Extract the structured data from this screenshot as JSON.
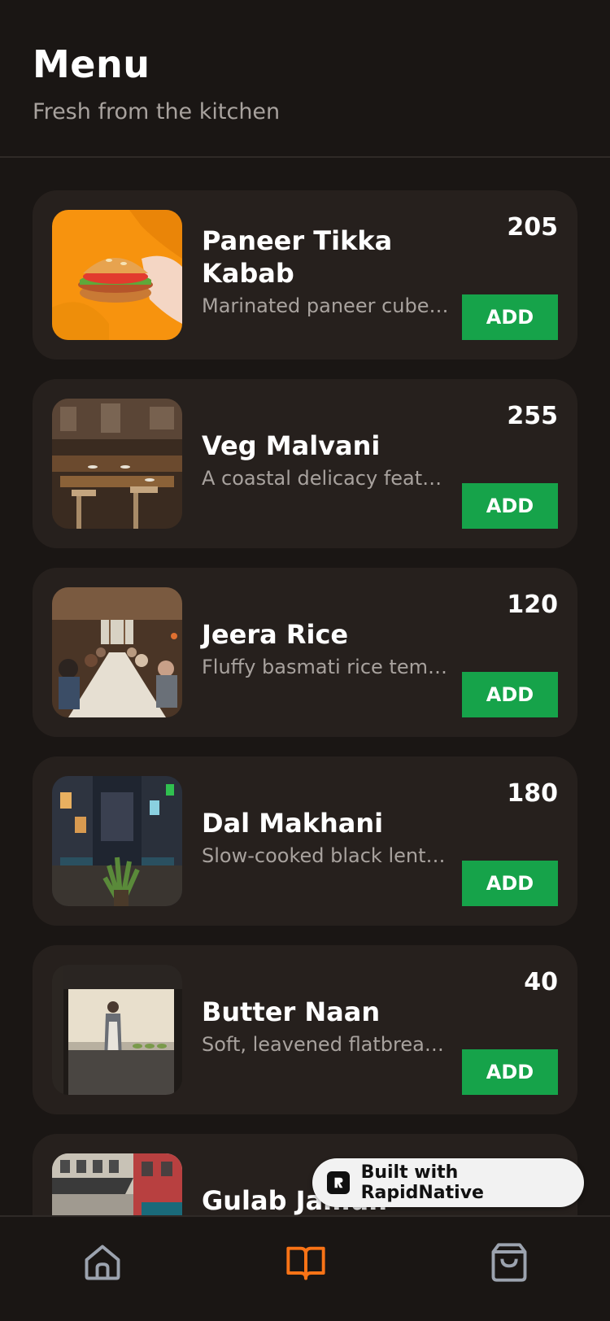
{
  "header": {
    "title": "Menu",
    "subtitle": "Fresh from the kitchen"
  },
  "menu": {
    "add_label": "ADD",
    "items": [
      {
        "name": "Paneer Tikka Kabab",
        "description": "Marinated paneer cubes grilled to perfection",
        "price": "205",
        "image": "burger-photo"
      },
      {
        "name": "Veg Malvani",
        "description": "A coastal delicacy featuring mixed vegetables",
        "price": "255",
        "image": "restaurant-dining-room-photo"
      },
      {
        "name": "Jeera Rice",
        "description": "Fluffy basmati rice tempered with cumin",
        "price": "120",
        "image": "dinner-party-photo"
      },
      {
        "name": "Dal Makhani",
        "description": "Slow-cooked black lentils in butter and cream",
        "price": "180",
        "image": "street-terrace-night-photo"
      },
      {
        "name": "Butter Naan",
        "description": "Soft, leavened flatbread brushed with butter",
        "price": "40",
        "image": "chef-kitchen-photo"
      },
      {
        "name": "Gulab Jamun",
        "description": "",
        "price": "",
        "image": "street-facade-photo"
      }
    ]
  },
  "badge": {
    "label": "Built with RapidNative",
    "icon": "rapidnative-logo-icon"
  },
  "tabbar": {
    "tabs": [
      {
        "name": "home",
        "icon": "home-icon",
        "active": false
      },
      {
        "name": "menu",
        "icon": "book-icon",
        "active": true
      },
      {
        "name": "cart",
        "icon": "shopping-bag-icon",
        "active": false
      }
    ],
    "active_color": "#f97316",
    "inactive_color": "#9ca3af"
  },
  "colors": {
    "background": "#1a1614",
    "card": "#26201d",
    "accent": "#16a34a",
    "muted_text": "#a8a29e"
  }
}
